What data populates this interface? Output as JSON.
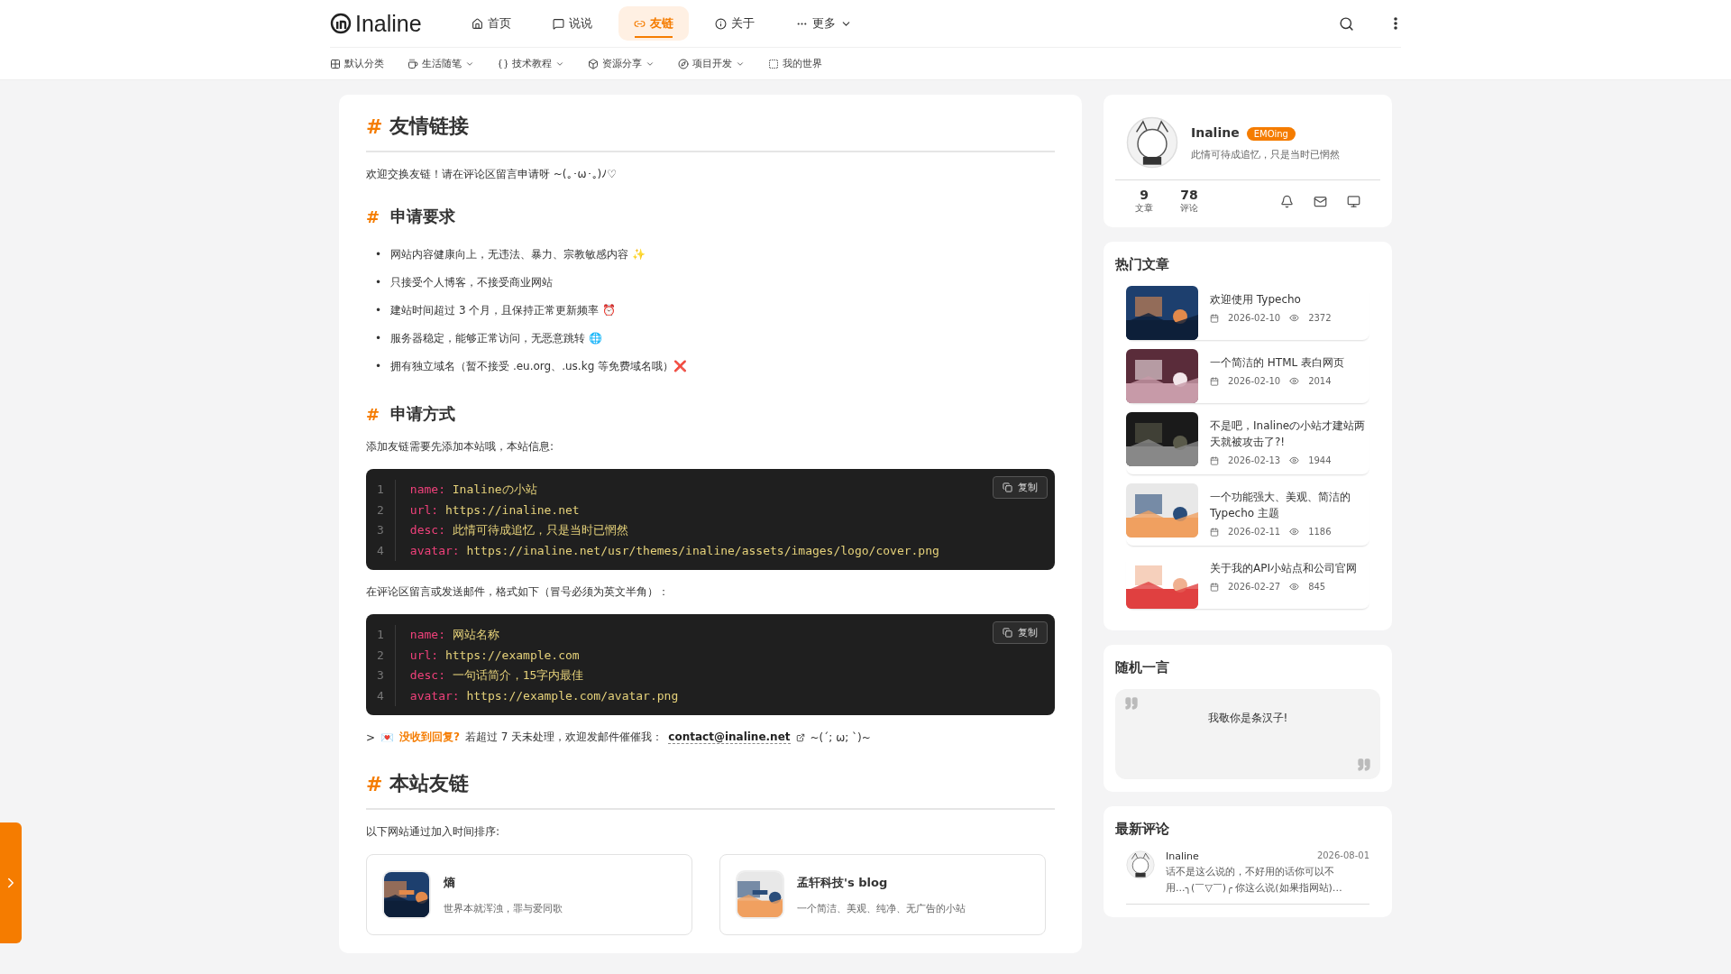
{
  "header": {
    "logo": "Inaline",
    "nav": [
      {
        "label": "首页",
        "selected": false,
        "dropdown": false
      },
      {
        "label": "说说",
        "selected": false,
        "dropdown": false
      },
      {
        "label": "友链",
        "selected": true,
        "dropdown": false
      },
      {
        "label": "关于",
        "selected": false,
        "dropdown": false
      },
      {
        "label": "更多",
        "selected": false,
        "dropdown": true
      }
    ]
  },
  "categories": [
    {
      "label": "默认分类",
      "dropdown": false
    },
    {
      "label": "生活随笔",
      "dropdown": true
    },
    {
      "label": "技术教程",
      "dropdown": true
    },
    {
      "label": "资源分享",
      "dropdown": true
    },
    {
      "label": "项目开发",
      "dropdown": true
    },
    {
      "label": "我的世界",
      "dropdown": false
    }
  ],
  "article": {
    "title": {
      "marker": "#",
      "text": "友情链接"
    },
    "intro": "欢迎交换友链！请在评论区留言申请呀 ~(｡･ω･｡)ﾉ♡",
    "requirements_heading": {
      "marker": "#",
      "text": "申请要求"
    },
    "requirements": [
      {
        "marker": "•",
        "text": "网站内容健康向上，无违法、暴力、宗教敏感内容 ✨"
      },
      {
        "marker": "•",
        "text": "只接受个人博客，不接受商业网站"
      },
      {
        "marker": "•",
        "text": "建站时间超过 3 个月，且保持正常更新频率 ⏰"
      },
      {
        "marker": "•",
        "text": "服务器稳定，能够正常访问，无恶意跳转 🌐"
      },
      {
        "marker": "•",
        "text": "拥有独立域名（暂不接受 .eu.org、.us.kg 等免费域名哦）❌"
      }
    ],
    "apply_heading": {
      "marker": "#",
      "text": "申请方式"
    },
    "apply_text": "添加友链需要先添加本站哦，本站信息:",
    "code_blocks": [
      {
        "copy_label": "复制",
        "lines": [
          {
            "number": "1",
            "key": "name:",
            "value": "Inalineの小站"
          },
          {
            "number": "2",
            "key": "url:",
            "value": "https://inaline.net"
          },
          {
            "number": "3",
            "key": "desc:",
            "value": "此情可待成追忆，只是当时已惘然"
          },
          {
            "number": "4",
            "key": "avatar:",
            "value": "https://inaline.net/usr/themes/inaline/assets/images/logo/cover.png"
          }
        ]
      },
      {
        "copy_label": "复制",
        "lines": [
          {
            "number": "1",
            "key": "name:",
            "value": "网站名称"
          },
          {
            "number": "2",
            "key": "url:",
            "value": "https://example.com"
          },
          {
            "number": "3",
            "key": "desc:",
            "value": "一句话简介，15字内最佳"
          },
          {
            "number": "4",
            "key": "avatar:",
            "value": "https://example.com/avatar.png"
          }
        ]
      }
    ],
    "format_text": "在评论区留言或发送邮件，格式如下（冒号必须为英文半角）：",
    "note": {
      "marker": ">",
      "emoji": "💌",
      "highlight": "没收到回复?",
      "text": "若超过 7 天未处理，欢迎发邮件催催我：",
      "email": "contact@inaline.net",
      "tail": "~(´; ω; `)~"
    },
    "links_heading": {
      "marker": "#",
      "text": "本站友链"
    },
    "links_intro": "以下网站通过加入时间排序:",
    "links": [
      {
        "name": "熵",
        "desc": "世界本就浑浊，罪与爱同歌"
      },
      {
        "name": "孟轩科技's blog",
        "desc": "一个简洁、美观、纯净、无广告的小站"
      }
    ]
  },
  "profile": {
    "name": "Inaline",
    "badge": "EMOing",
    "motto": "此情可待成追忆，只是当时已惘然",
    "stats": [
      {
        "value": "9",
        "label": "文章"
      },
      {
        "value": "78",
        "label": "评论"
      }
    ]
  },
  "hot": {
    "title": "热门文章",
    "posts": [
      {
        "title": "欢迎使用 Typecho",
        "date": "2026-02-10",
        "views": "2372"
      },
      {
        "title": "一个简洁的 HTML 表白网页",
        "date": "2026-02-10",
        "views": "2014"
      },
      {
        "title": "不是吧，Inalineの小站才建站两天就被攻击了?!",
        "date": "2026-02-13",
        "views": "1944"
      },
      {
        "title": "一个功能强大、美观、简洁的 Typecho 主题",
        "date": "2026-02-11",
        "views": "1186"
      },
      {
        "title": "关于我的API小站点和公司官网",
        "date": "2026-02-27",
        "views": "845"
      }
    ]
  },
  "quote": {
    "title": "随机一言",
    "text": "我敬你是条汉子!"
  },
  "comments": {
    "title": "最新评论",
    "items": [
      {
        "author": "Inaline",
        "date": "2026-08-01",
        "text": "话不是这么说的，不好用的话你可以不用...╮(￣▽￣)╭ 你这么说(如果指网站)…"
      }
    ]
  }
}
